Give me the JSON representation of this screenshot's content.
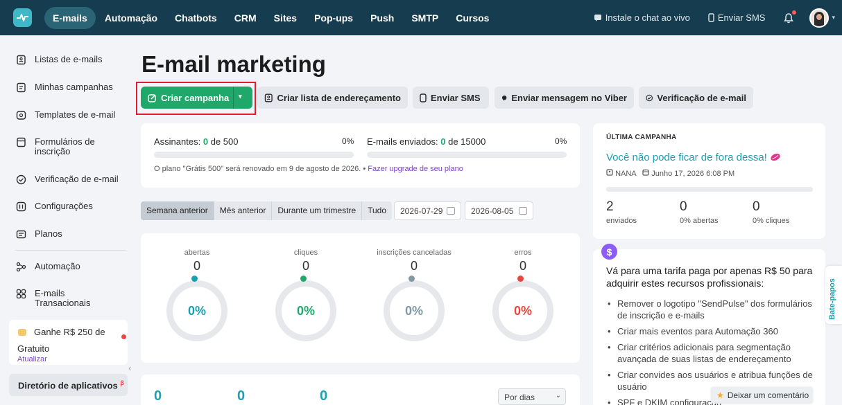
{
  "topnav": {
    "items": [
      "E-mails",
      "Automação",
      "Chatbots",
      "CRM",
      "Sites",
      "Pop-ups",
      "Push",
      "SMTP",
      "Cursos"
    ],
    "active": "E-mails",
    "install_chat": "Instale o chat ao vivo",
    "send_sms": "Enviar SMS"
  },
  "sidebar": {
    "items": [
      {
        "label": "Listas de e-mails",
        "icon": "list-icon"
      },
      {
        "label": "Minhas campanhas",
        "icon": "campaign-icon"
      },
      {
        "label": "Templates de e-mail",
        "icon": "template-icon"
      },
      {
        "label": "Formulários de inscrição",
        "icon": "form-icon"
      },
      {
        "label": "Verificação de e-mail",
        "icon": "check-circle-icon"
      },
      {
        "label": "Configurações",
        "icon": "settings-icon"
      },
      {
        "label": "Planos",
        "icon": "plans-icon"
      },
      {
        "label": "Automação",
        "icon": "automation-icon"
      },
      {
        "label": "E-mails Transacionais",
        "icon": "transactional-icon"
      }
    ],
    "promo": {
      "title": "Ganhe R$ 250 de",
      "title2": "Gratuito",
      "link": "Atualizar"
    },
    "directory": "Diretório de aplicativos",
    "directory_badge": "β"
  },
  "main": {
    "title": "E-mail marketing",
    "buttons": {
      "create_campaign": "Criar campanha",
      "create_list": "Criar lista de endereçamento",
      "send_sms": "Enviar SMS",
      "viber": "Enviar mensagem no Viber",
      "verify": "Verificação de e-mail"
    },
    "plan": {
      "subscribers_label": "Assinantes:",
      "subscribers_value": "0",
      "subscribers_of": "de 500",
      "subscribers_pct": "0%",
      "sent_label": "E-mails enviados:",
      "sent_value": "0",
      "sent_of": "de 15000",
      "sent_pct": "0%",
      "note": "O plano \"Grátis 500\" será renovado em 9 de agosto de 2026. •",
      "upgrade": "Fazer upgrade de seu plano"
    },
    "periods": [
      "Semana anterior",
      "Mês anterior",
      "Durante um trimestre",
      "Tudo"
    ],
    "active_period": "Semana anterior",
    "date_from": "2026-07-29",
    "date_to": "2026-08-05",
    "metrics": [
      {
        "label": "abertas",
        "value": "0",
        "pct": "0%",
        "color": "#1aa0b0"
      },
      {
        "label": "cliques",
        "value": "0",
        "pct": "0%",
        "color": "#20a86a"
      },
      {
        "label": "inscrições canceladas",
        "value": "0",
        "pct": "0%",
        "color": "#7f9aa3"
      },
      {
        "label": "erros",
        "value": "0",
        "pct": "0%",
        "color": "#e8453c"
      }
    ],
    "bottom_numbers": [
      "0",
      "0",
      "0"
    ],
    "group_by": "Por dias"
  },
  "last_campaign": {
    "heading": "ÚLTIMA CAMPANHA",
    "name": "Você não pode ficar de fora dessa!",
    "sender": "NANA",
    "date": "Junho 17, 2026 6:08 PM",
    "stats": [
      {
        "value": "2",
        "label": "enviados"
      },
      {
        "value": "0",
        "label": "0% abertas"
      },
      {
        "value": "0",
        "label": "0% cliques"
      }
    ]
  },
  "upgrade": {
    "title": "Vá para uma tarifa paga por apenas R$ 50 para adquirir estes recursos profissionais:",
    "features": [
      "Remover o logotipo \"SendPulse\" dos formulários de inscrição e e-mails",
      "Criar mais eventos para Automação 360",
      "Criar critérios adicionais para segmentação avançada de suas listas de endereçamento",
      "Criar convides aos usuários e atribua funções de usuário",
      "SPF e DKIM configuração"
    ]
  },
  "feedback": "Deixar um comentário",
  "chat_tab": "Bate-papos"
}
